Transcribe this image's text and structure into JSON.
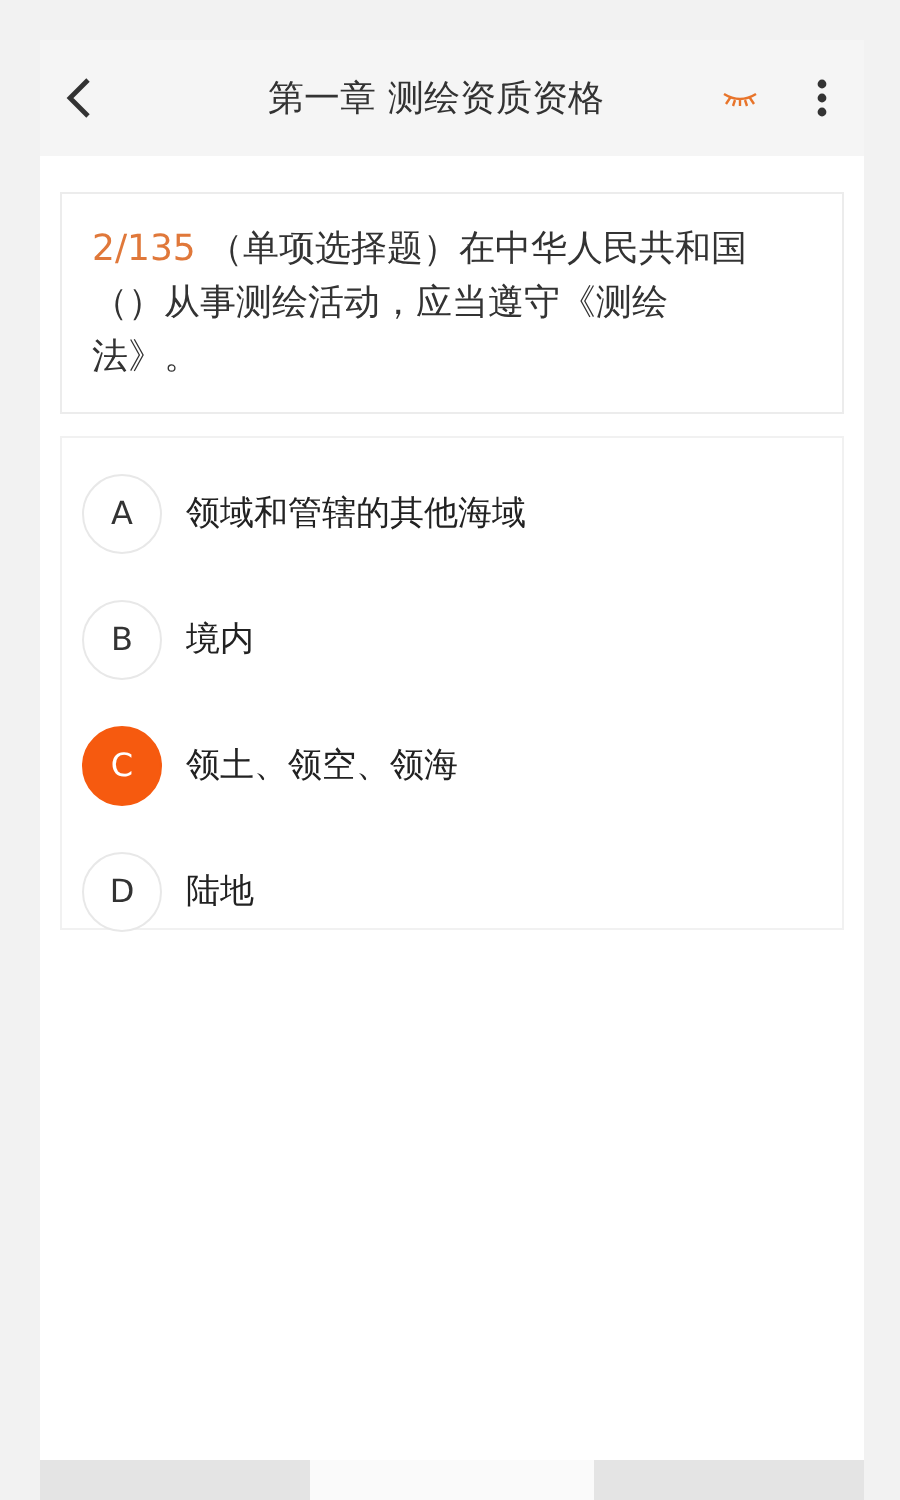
{
  "header": {
    "title": "第一章 测绘资质资格"
  },
  "question": {
    "number": "2/135",
    "text": "（单项选择题）在中华人民共和国（）从事测绘活动，应当遵守《测绘法》。"
  },
  "options": [
    {
      "letter": "A",
      "text": "领域和管辖的其他海域",
      "selected": false
    },
    {
      "letter": "B",
      "text": "境内",
      "selected": false
    },
    {
      "letter": "C",
      "text": "领土、领空、领海",
      "selected": true
    },
    {
      "letter": "D",
      "text": "陆地",
      "selected": false
    }
  ],
  "bottom_bar": [
    {
      "selected": false
    },
    {
      "selected": true
    },
    {
      "selected": false
    }
  ]
}
